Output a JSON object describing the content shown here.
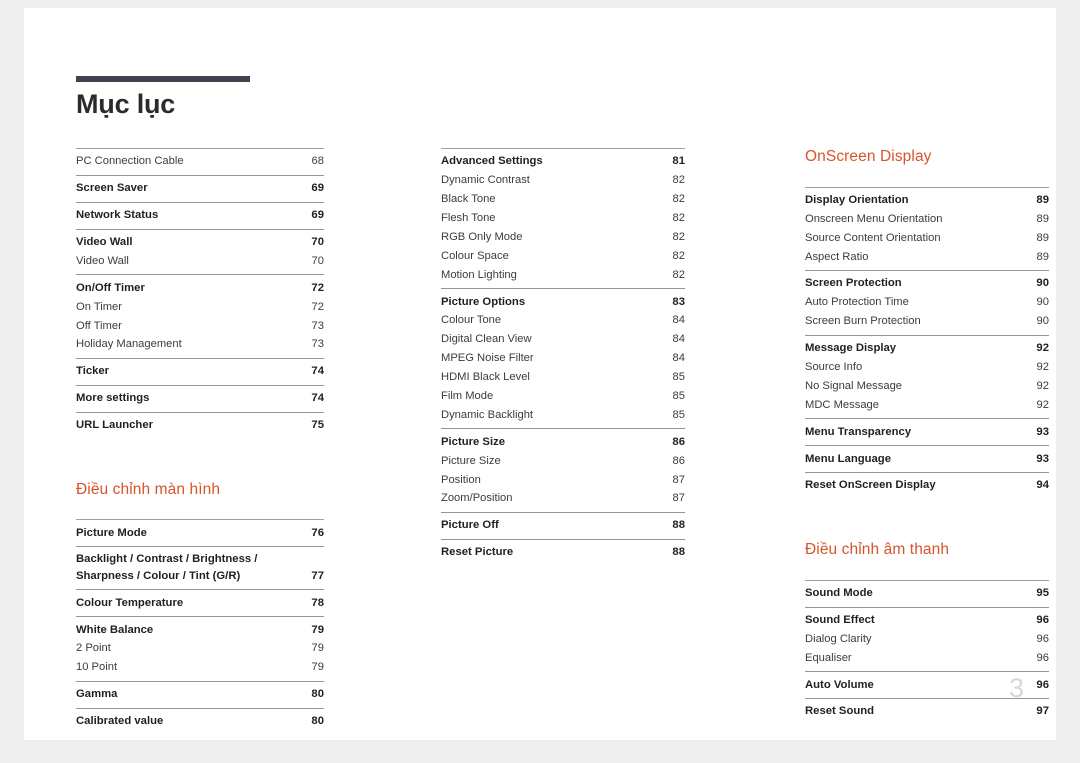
{
  "document": {
    "title": "Mục lục",
    "folio": "3"
  },
  "columns": [
    {
      "id": "column-1",
      "heading": null,
      "groups": [
        {
          "rows": [
            {
              "label": "PC Connection Cable",
              "page": "68",
              "bold": false
            }
          ]
        },
        {
          "rows": [
            {
              "label": "Screen Saver",
              "page": "69",
              "bold": true
            }
          ]
        },
        {
          "rows": [
            {
              "label": "Network Status",
              "page": "69",
              "bold": true
            }
          ]
        },
        {
          "rows": [
            {
              "label": "Video Wall",
              "page": "70",
              "bold": true
            },
            {
              "label": "Video Wall",
              "page": "70",
              "bold": false
            }
          ]
        },
        {
          "rows": [
            {
              "label": "On/Off Timer",
              "page": "72",
              "bold": true
            },
            {
              "label": "On Timer",
              "page": "72",
              "bold": false
            },
            {
              "label": "Off Timer",
              "page": "73",
              "bold": false
            },
            {
              "label": "Holiday Management",
              "page": "73",
              "bold": false
            }
          ]
        },
        {
          "rows": [
            {
              "label": "Ticker",
              "page": "74",
              "bold": true
            }
          ]
        },
        {
          "rows": [
            {
              "label": "More settings",
              "page": "74",
              "bold": true
            }
          ]
        },
        {
          "rows": [
            {
              "label": "URL Launcher",
              "page": "75",
              "bold": true
            }
          ]
        }
      ],
      "heading2": "Điều chỉnh màn hình",
      "groups2": [
        {
          "rows": [
            {
              "label": "Picture Mode",
              "page": "76",
              "bold": true
            }
          ]
        },
        {
          "rows": [
            {
              "label": "Backlight / Contrast / Brightness /\nSharpness / Colour / Tint (G/R)",
              "page": "77",
              "bold": true,
              "twoLine": true
            }
          ]
        },
        {
          "rows": [
            {
              "label": "Colour Temperature",
              "page": "78",
              "bold": true
            }
          ]
        },
        {
          "rows": [
            {
              "label": "White Balance",
              "page": "79",
              "bold": true
            },
            {
              "label": "2 Point",
              "page": "79",
              "bold": false
            },
            {
              "label": "10 Point",
              "page": "79",
              "bold": false
            }
          ]
        },
        {
          "rows": [
            {
              "label": "Gamma",
              "page": "80",
              "bold": true
            }
          ]
        },
        {
          "rows": [
            {
              "label": "Calibrated value",
              "page": "80",
              "bold": true
            }
          ]
        }
      ]
    },
    {
      "id": "column-2",
      "heading": null,
      "groups": [
        {
          "rows": [
            {
              "label": "Advanced Settings",
              "page": "81",
              "bold": true
            },
            {
              "label": "Dynamic Contrast",
              "page": "82",
              "bold": false
            },
            {
              "label": "Black Tone",
              "page": "82",
              "bold": false
            },
            {
              "label": "Flesh Tone",
              "page": "82",
              "bold": false
            },
            {
              "label": "RGB Only Mode",
              "page": "82",
              "bold": false
            },
            {
              "label": "Colour Space",
              "page": "82",
              "bold": false
            },
            {
              "label": "Motion Lighting",
              "page": "82",
              "bold": false
            }
          ]
        },
        {
          "rows": [
            {
              "label": "Picture Options",
              "page": "83",
              "bold": true
            },
            {
              "label": "Colour Tone",
              "page": "84",
              "bold": false
            },
            {
              "label": "Digital Clean View",
              "page": "84",
              "bold": false
            },
            {
              "label": "MPEG Noise Filter",
              "page": "84",
              "bold": false
            },
            {
              "label": "HDMI Black Level",
              "page": "85",
              "bold": false
            },
            {
              "label": "Film Mode",
              "page": "85",
              "bold": false
            },
            {
              "label": "Dynamic Backlight",
              "page": "85",
              "bold": false
            }
          ]
        },
        {
          "rows": [
            {
              "label": "Picture Size",
              "page": "86",
              "bold": true
            },
            {
              "label": "Picture Size",
              "page": "86",
              "bold": false
            },
            {
              "label": "Position",
              "page": "87",
              "bold": false
            },
            {
              "label": "Zoom/Position",
              "page": "87",
              "bold": false
            }
          ]
        },
        {
          "rows": [
            {
              "label": "Picture Off",
              "page": "88",
              "bold": true
            }
          ]
        },
        {
          "rows": [
            {
              "label": "Reset Picture",
              "page": "88",
              "bold": true
            }
          ]
        }
      ]
    },
    {
      "id": "column-3",
      "heading": "OnScreen Display",
      "groups": [
        {
          "rows": [
            {
              "label": "Display Orientation",
              "page": "89",
              "bold": true
            },
            {
              "label": "Onscreen Menu Orientation",
              "page": "89",
              "bold": false
            },
            {
              "label": "Source Content Orientation",
              "page": "89",
              "bold": false
            },
            {
              "label": "Aspect Ratio",
              "page": "89",
              "bold": false
            }
          ]
        },
        {
          "rows": [
            {
              "label": "Screen Protection",
              "page": "90",
              "bold": true
            },
            {
              "label": "Auto Protection Time",
              "page": "90",
              "bold": false
            },
            {
              "label": "Screen Burn Protection",
              "page": "90",
              "bold": false
            }
          ]
        },
        {
          "rows": [
            {
              "label": "Message Display",
              "page": "92",
              "bold": true
            },
            {
              "label": "Source Info",
              "page": "92",
              "bold": false
            },
            {
              "label": "No Signal Message",
              "page": "92",
              "bold": false
            },
            {
              "label": "MDC Message",
              "page": "92",
              "bold": false
            }
          ]
        },
        {
          "rows": [
            {
              "label": "Menu Transparency",
              "page": "93",
              "bold": true
            }
          ]
        },
        {
          "rows": [
            {
              "label": "Menu Language",
              "page": "93",
              "bold": true
            }
          ]
        },
        {
          "rows": [
            {
              "label": "Reset OnScreen Display",
              "page": "94",
              "bold": true
            }
          ]
        }
      ],
      "heading2": "Điều chỉnh âm thanh",
      "groups2": [
        {
          "rows": [
            {
              "label": "Sound Mode",
              "page": "95",
              "bold": true
            }
          ]
        },
        {
          "rows": [
            {
              "label": "Sound Effect",
              "page": "96",
              "bold": true
            },
            {
              "label": "Dialog Clarity",
              "page": "96",
              "bold": false
            },
            {
              "label": "Equaliser",
              "page": "96",
              "bold": false
            }
          ]
        },
        {
          "rows": [
            {
              "label": "Auto Volume",
              "page": "96",
              "bold": true
            }
          ]
        },
        {
          "rows": [
            {
              "label": "Reset Sound",
              "page": "97",
              "bold": true
            }
          ]
        }
      ]
    }
  ],
  "colors": {
    "accent": "#d8542b",
    "rule": "#434250",
    "text": "#3c3c3c",
    "folio": "#d7d7d7"
  }
}
